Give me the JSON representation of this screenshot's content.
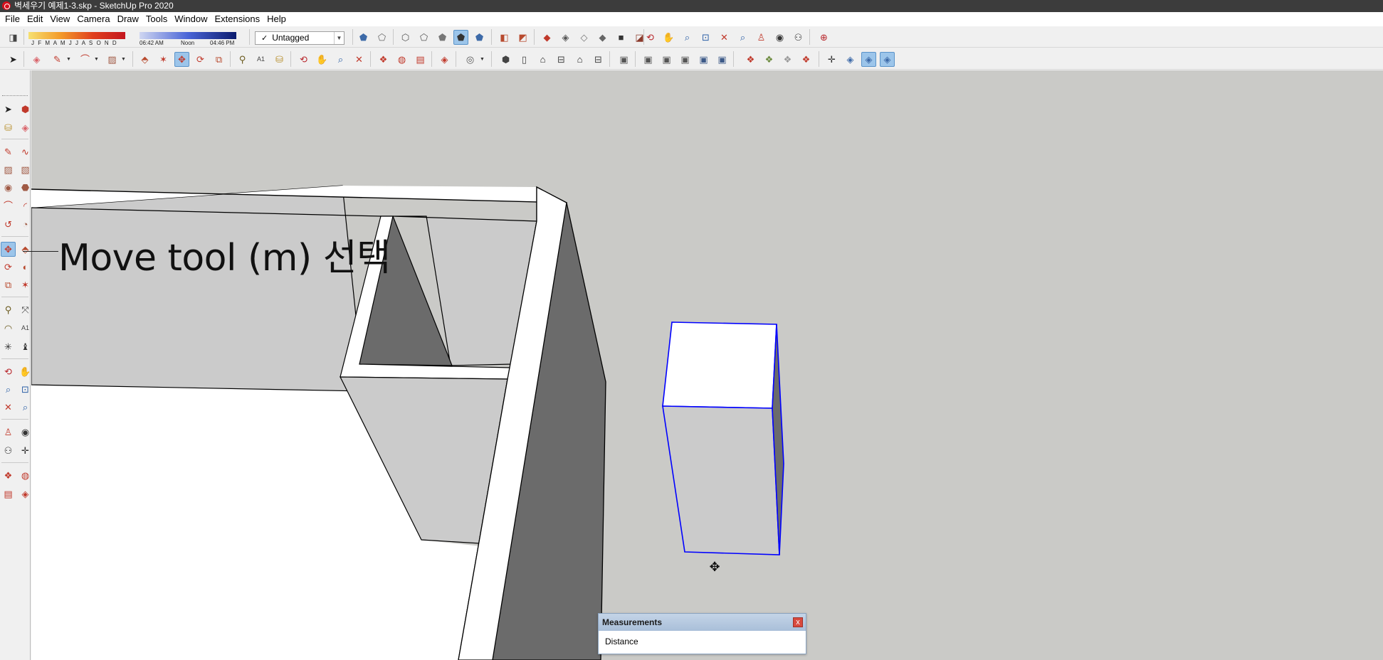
{
  "window": {
    "title": "벽세우기 예제1-3.skp - SketchUp Pro 2020"
  },
  "menu": [
    "File",
    "Edit",
    "View",
    "Camera",
    "Draw",
    "Tools",
    "Window",
    "Extensions",
    "Help"
  ],
  "shadows": {
    "months": "J F M A M J J A S O N D",
    "time_start": "06:42 AM",
    "time_noon": "Noon",
    "time_end": "04:46 PM"
  },
  "tag": {
    "selected": "Untagged",
    "check": "✓"
  },
  "annotation": {
    "text": "Move tool (m) 선택"
  },
  "measurements": {
    "title": "Measurements",
    "label": "Distance",
    "value": "",
    "close": "x"
  },
  "colors": {
    "viewport_bg": "#cacac7",
    "selection": "#0000ff",
    "face_light": "#ffffff",
    "face_gray": "#cbcbcb",
    "face_dark": "#6b6b6b"
  },
  "toolbar_icons": {
    "row1": [
      "eraser-icon",
      "xray-icon",
      "wireframe-icon",
      "back-edges-icon",
      "hidden-line-icon",
      "shaded-icon",
      "shaded-textures-icon",
      "monochrome-icon",
      "section-plane-icon",
      "section-display-icon",
      "section-fill-icon",
      "orbit-icon",
      "pan-icon",
      "zoom-icon",
      "zoom-window-icon",
      "zoom-extents-icon",
      "position-camera-icon",
      "look-around-icon",
      "walk-icon",
      "geo-location-icon"
    ],
    "row2": [
      "select-icon",
      "eraser-icon",
      "pencil-icon",
      "arc-icon",
      "rectangle-icon",
      "push-pull-icon",
      "follow-me-icon",
      "move-icon",
      "rotate-icon",
      "scale-icon",
      "tape-measure-icon",
      "text-icon",
      "paint-bucket-icon",
      "orbit-icon",
      "pan-icon",
      "zoom-icon",
      "zoom-extents-icon",
      "components-icon",
      "materials-icon",
      "styles-icon",
      "layers-icon",
      "profile-icon",
      "iso-view-icon",
      "top-view-icon",
      "front-view-icon",
      "right-view-icon",
      "back-view-icon",
      "left-view-icon",
      "sandbox-icon",
      "solid-tools-icons",
      "warehouse-icon",
      "extension-warehouse-icon",
      "layout-icon",
      "ruby-console-icon",
      "axes-icon",
      "guides-icon",
      "dim-icon",
      "camera-icon"
    ]
  }
}
